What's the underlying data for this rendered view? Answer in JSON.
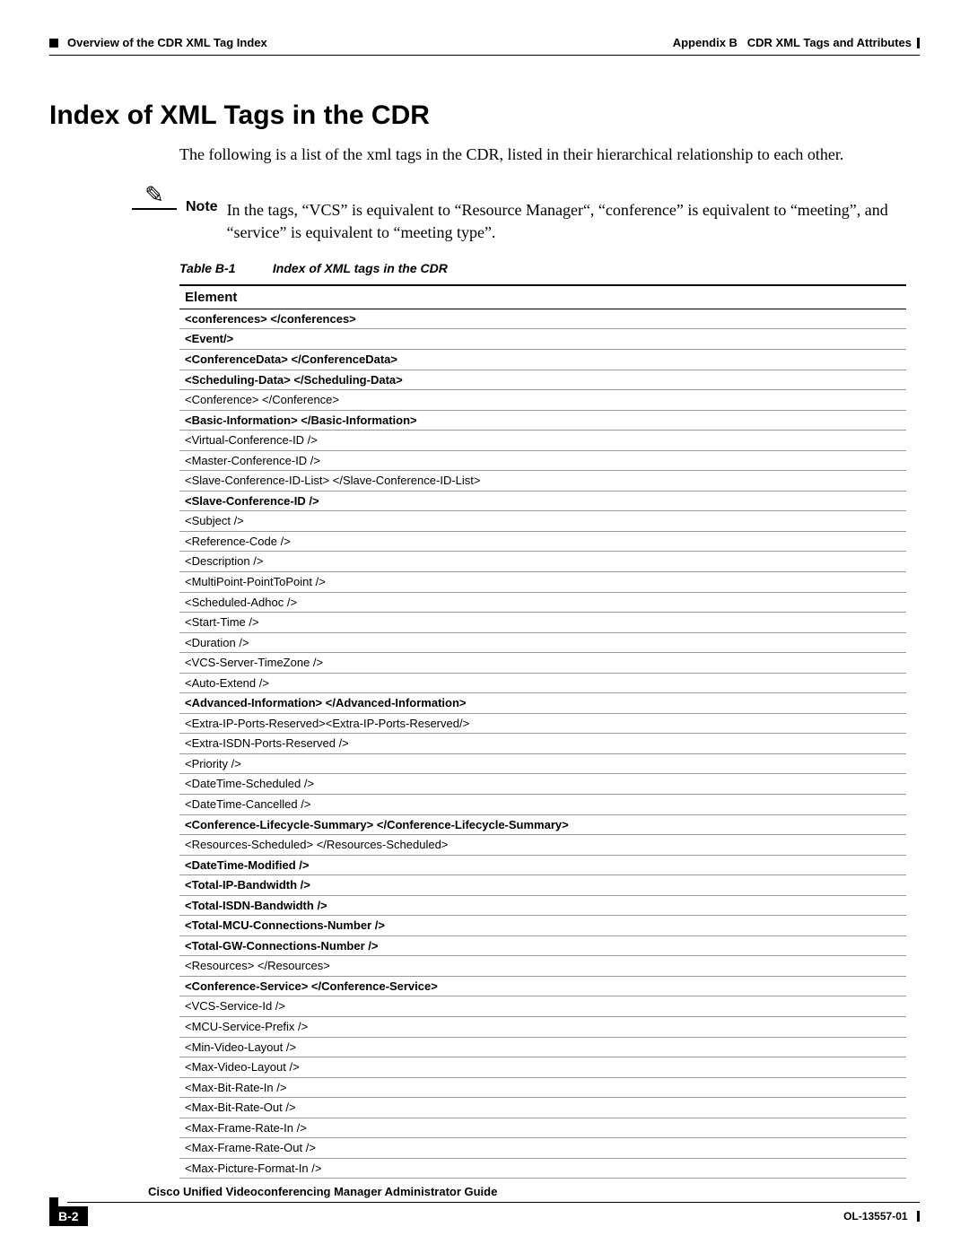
{
  "header": {
    "left": "Overview of the CDR XML Tag Index",
    "right_prefix": "Appendix B",
    "right_title": "CDR XML Tags and Attributes"
  },
  "title": "Index of XML Tags in the CDR",
  "intro": "The following is a list of the xml tags in the CDR, listed in their hierarchical relationship to each other.",
  "note_label": "Note",
  "note_text": "In the tags, “VCS” is equivalent to “Resource Manager“, “conference” is equivalent to “meeting”, and “service” is equivalent to “meeting type”.",
  "table": {
    "id": "Table B-1",
    "caption": "Index of XML tags in the CDR",
    "header": "Element",
    "rows": [
      {
        "text": "<conferences> </conferences>",
        "indent": 0,
        "bold": true
      },
      {
        "text": "<Event/>",
        "indent": 1,
        "bold": true
      },
      {
        "text": "<ConferenceData> </ConferenceData>",
        "indent": 2,
        "bold": true
      },
      {
        "text": "<Scheduling-Data> </Scheduling-Data>",
        "indent": 2,
        "bold": true
      },
      {
        "text": "<Conference> </Conference>",
        "indent": 3,
        "bold": false
      },
      {
        "text": "<Basic-Information> </Basic-Information>",
        "indent": 4,
        "bold": true
      },
      {
        "text": "<Virtual-Conference-ID />",
        "indent": 5,
        "bold": false
      },
      {
        "text": "<Master-Conference-ID />",
        "indent": 5,
        "bold": false
      },
      {
        "text": "<Slave-Conference-ID-List> </Slave-Conference-ID-List>",
        "indent": 5,
        "bold": false
      },
      {
        "text": "<Slave-Conference-ID />",
        "indent": 6,
        "bold": true
      },
      {
        "text": "<Subject />",
        "indent": 5,
        "bold": false
      },
      {
        "text": "<Reference-Code />",
        "indent": 5,
        "bold": false
      },
      {
        "text": "<Description />",
        "indent": 5,
        "bold": false
      },
      {
        "text": "<MultiPoint-PointToPoint />",
        "indent": 5,
        "bold": false
      },
      {
        "text": "<Scheduled-Adhoc />",
        "indent": 5,
        "bold": false
      },
      {
        "text": "<Start-Time />",
        "indent": 5,
        "bold": false
      },
      {
        "text": "<Duration />",
        "indent": 5,
        "bold": false
      },
      {
        "text": "<VCS-Server-TimeZone />",
        "indent": 5,
        "bold": false
      },
      {
        "text": "<Auto-Extend />",
        "indent": 5,
        "bold": false
      },
      {
        "text": "<Advanced-Information> </Advanced-Information>",
        "indent": 4,
        "bold": true
      },
      {
        "text": "<Extra-IP-Ports-Reserved><Extra-IP-Ports-Reserved/>",
        "indent": 5,
        "bold": false
      },
      {
        "text": "<Extra-ISDN-Ports-Reserved />",
        "indent": 5,
        "bold": false
      },
      {
        "text": "<Priority />",
        "indent": 5,
        "bold": false
      },
      {
        "text": "<DateTime-Scheduled />",
        "indent": 5,
        "bold": false
      },
      {
        "text": "<DateTime-Cancelled />",
        "indent": 5,
        "bold": false
      },
      {
        "text": "<Conference-Lifecycle-Summary> </Conference-Lifecycle-Summary>",
        "indent": 4,
        "bold": true
      },
      {
        "text": "<Resources-Scheduled> </Resources-Scheduled>",
        "indent": 5,
        "bold": false
      },
      {
        "text": "<DateTime-Modified />",
        "indent": 6,
        "bold": true
      },
      {
        "text": "<Total-IP-Bandwidth />",
        "indent": 6,
        "bold": true
      },
      {
        "text": "<Total-ISDN-Bandwidth />",
        "indent": 6,
        "bold": true
      },
      {
        "text": "<Total-MCU-Connections-Number />",
        "indent": 6,
        "bold": true
      },
      {
        "text": "<Total-GW-Connections-Number />",
        "indent": 6,
        "bold": true
      },
      {
        "text": "<Resources> </Resources>",
        "indent": 3,
        "bold": false
      },
      {
        "text": "<Conference-Service> </Conference-Service>",
        "indent": 4,
        "bold": true
      },
      {
        "text": "<VCS-Service-Id />",
        "indent": 5,
        "bold": false
      },
      {
        "text": "<MCU-Service-Prefix />",
        "indent": 5,
        "bold": false
      },
      {
        "text": "<Min-Video-Layout />",
        "indent": 5,
        "bold": false
      },
      {
        "text": "<Max-Video-Layout />",
        "indent": 5,
        "bold": false
      },
      {
        "text": "<Max-Bit-Rate-In />",
        "indent": 5,
        "bold": false
      },
      {
        "text": "<Max-Bit-Rate-Out />",
        "indent": 5,
        "bold": false
      },
      {
        "text": "<Max-Frame-Rate-In />",
        "indent": 5,
        "bold": false
      },
      {
        "text": "<Max-Frame-Rate-Out />",
        "indent": 5,
        "bold": false
      },
      {
        "text": "<Max-Picture-Format-In />",
        "indent": 5,
        "bold": false
      }
    ]
  },
  "footer": {
    "guide_title": "Cisco Unified Videoconferencing Manager Administrator Guide",
    "page_num": "B-2",
    "doc_id": "OL-13557-01"
  }
}
